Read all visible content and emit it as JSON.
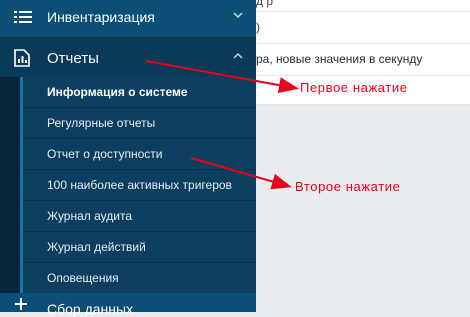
{
  "content": {
    "rows": [
      "д     р",
      ")",
      "ра, новые значения в секунду",
      ""
    ]
  },
  "sidebar": {
    "inventory": {
      "label": "Инвентаризация",
      "icon": "list-icon",
      "chevron": "chevron-down-icon"
    },
    "reports": {
      "label": "Отчеты",
      "icon": "report-icon",
      "chevron": "chevron-up-icon"
    },
    "submenu": [
      {
        "label": "Информация о системе"
      },
      {
        "label": "Регулярные отчеты"
      },
      {
        "label": "Отчет о доступности"
      },
      {
        "label": "100 наиболее активных тригеров"
      },
      {
        "label": "Журнал аудита"
      },
      {
        "label": "Журнал действий"
      },
      {
        "label": "Оповещения"
      }
    ],
    "collection": {
      "label": "Сбор данных",
      "icon": "plus-icon"
    }
  },
  "annotations": {
    "first": "Первое нажатие",
    "second": "Второе нажатие",
    "color": "#e8001c"
  },
  "colors": {
    "sidebar": "#0a466a",
    "submenu": "#0c3e60",
    "rail": "#08263b"
  }
}
